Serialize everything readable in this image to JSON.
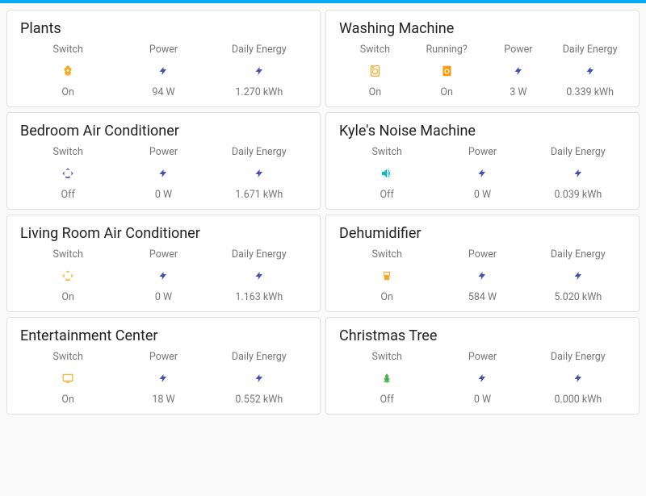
{
  "labels": {
    "switch": "Switch",
    "power": "Power",
    "daily_energy": "Daily Energy",
    "running": "Running?"
  },
  "cards": [
    {
      "title": "Plants",
      "type": "three",
      "switch_icon": "flower",
      "switch_color": "yellow",
      "switch_state": "On",
      "power_icon": "bolt",
      "power_color": "blue",
      "power_value": "94 W",
      "energy_icon": "bolt",
      "energy_color": "blue",
      "energy_value": "1.270 kWh"
    },
    {
      "title": "Washing Machine",
      "type": "four",
      "switch_icon": "washer-outline",
      "switch_color": "yellow",
      "switch_state": "On",
      "running_icon": "washer",
      "running_color": "orange",
      "running_state": "On",
      "power_icon": "bolt",
      "power_color": "blue",
      "power_value": "3 W",
      "energy_icon": "bolt",
      "energy_color": "blue",
      "energy_value": "0.339 kWh"
    },
    {
      "title": "Bedroom Air Conditioner",
      "type": "three",
      "switch_icon": "ac",
      "switch_color": "blue",
      "switch_state": "Off",
      "power_icon": "bolt",
      "power_color": "blue",
      "power_value": "0 W",
      "energy_icon": "bolt",
      "energy_color": "blue",
      "energy_value": "1.671 kWh"
    },
    {
      "title": "Kyle's Noise Machine",
      "type": "three",
      "switch_icon": "speaker",
      "switch_color": "teal",
      "switch_state": "Off",
      "power_icon": "bolt",
      "power_color": "blue",
      "power_value": "0 W",
      "energy_icon": "bolt",
      "energy_color": "blue",
      "energy_value": "0.039 kWh"
    },
    {
      "title": "Living Room Air Conditioner",
      "type": "three",
      "switch_icon": "ac",
      "switch_color": "yellow",
      "switch_state": "On",
      "power_icon": "bolt",
      "power_color": "blue",
      "power_value": "0 W",
      "energy_icon": "bolt",
      "energy_color": "blue",
      "energy_value": "1.163 kWh"
    },
    {
      "title": "Dehumidifier",
      "type": "three",
      "switch_icon": "cup",
      "switch_color": "yellow",
      "switch_state": "On",
      "power_icon": "bolt",
      "power_color": "blue",
      "power_value": "584 W",
      "energy_icon": "bolt",
      "energy_color": "blue",
      "energy_value": "5.020 kWh"
    },
    {
      "title": "Entertainment Center",
      "type": "three",
      "switch_icon": "tv",
      "switch_color": "yellow",
      "switch_state": "On",
      "power_icon": "bolt",
      "power_color": "blue",
      "power_value": "18 W",
      "energy_icon": "bolt",
      "energy_color": "blue",
      "energy_value": "0.552 kWh"
    },
    {
      "title": "Christmas Tree",
      "type": "three",
      "switch_icon": "tree",
      "switch_color": "green",
      "switch_state": "Off",
      "power_icon": "bolt",
      "power_color": "blue",
      "power_value": "0 W",
      "energy_icon": "bolt",
      "energy_color": "blue",
      "energy_value": "0.000 kWh"
    }
  ]
}
